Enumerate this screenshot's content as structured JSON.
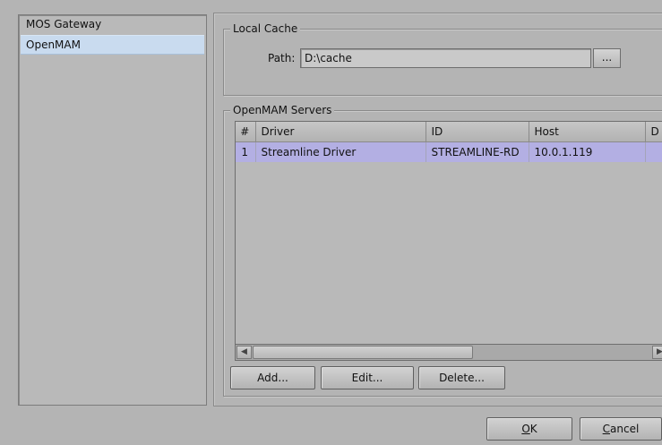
{
  "nav": {
    "items": [
      {
        "label": "MOS Gateway",
        "selected": false
      },
      {
        "label": "OpenMAM",
        "selected": true
      }
    ]
  },
  "local_cache": {
    "title": "Local Cache",
    "path_label": "Path:",
    "path_value": "D:\\cache",
    "browse_label": "..."
  },
  "servers": {
    "title": "OpenMAM Servers",
    "columns": [
      "#",
      "Driver",
      "ID",
      "Host",
      "D"
    ],
    "rows": [
      {
        "num": "1",
        "driver": "Streamline Driver",
        "id": "STREAMLINE-RD",
        "host": "10.0.1.119",
        "extra": ""
      }
    ],
    "buttons": {
      "add": "Add...",
      "edit": "Edit...",
      "delete": "Delete..."
    }
  },
  "dialog": {
    "ok_mnemonic": "O",
    "ok_rest": "K",
    "cancel_mnemonic": "C",
    "cancel_rest": "ancel"
  },
  "colors": {
    "selection_row": "#b3afe3",
    "nav_selected": "#c9dbef",
    "background": "#b4b4b4"
  }
}
